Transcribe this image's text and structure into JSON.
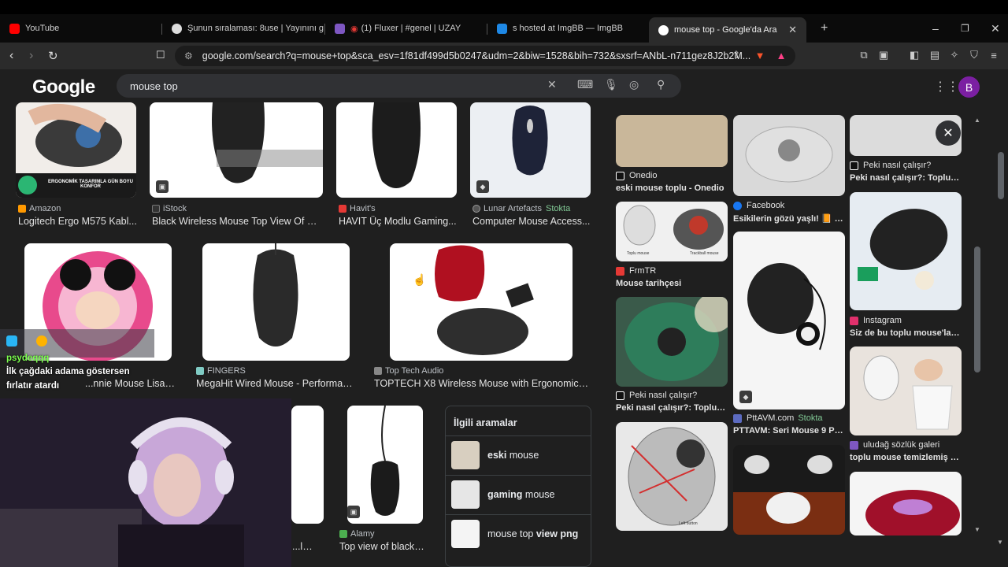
{
  "browser": {
    "tabs": [
      {
        "title": "YouTube",
        "color": "#ff0000"
      },
      {
        "title": "Şunun sıralaması: 8use | Yayınını güçl",
        "color": "#dddddd"
      },
      {
        "title": "(1) Fluxer | #genel | UZAY",
        "color": "#7e57c2"
      },
      {
        "title": "s hosted at ImgBB — ImgBB",
        "color": "#1e88e5"
      },
      {
        "title": "mouse top - Google'da Ara",
        "color": "#ffffff"
      }
    ],
    "new_tab": "+",
    "url": "google.com/search?q=mouse+top&sca_esv=1f81df499d5b0247&udm=2&biw=1528&bih=732&sxsrf=ANbL-n711gez8J2b2M..."
  },
  "google": {
    "logo": "Google",
    "query": "mouse top",
    "avatar": "B"
  },
  "left_results": [
    {
      "source": "Amazon",
      "title": "Logitech Ergo M575 Kabl...",
      "banner": "ERGONOMİK TASARIMLA GÜN BOYU KONFOR",
      "fav": "#ff9900"
    },
    {
      "source": "iStock",
      "title": "Black Wireless Mouse Top View Of G...",
      "fav": "#333333"
    },
    {
      "source": "Havit's",
      "title": "HAVIT Üç Modlu Gaming...",
      "fav": "#e53935"
    },
    {
      "source": "Lunar Artefacts",
      "stock": "Stokta",
      "title": "Computer Mouse Access...",
      "fav": "#555555"
    },
    {
      "source": "",
      "title": "...nnie Mouse Lisanslı Plast...",
      "fav": "#e91e63"
    },
    {
      "source": "FINGERS",
      "title": "MegaHit Wired Mouse - Performan...",
      "fav": "#80cbc4"
    },
    {
      "source": "Top Tech Audio",
      "title": "TOPTECH X8 Wireless Mouse with Ergonomic S...",
      "fav": "#888888"
    },
    {
      "source": "Alamy",
      "title": "Top view of black c...",
      "fav": "#4caf50"
    },
    {
      "partial_title": "...less"
    }
  ],
  "related": {
    "heading": "İlgili aramalar",
    "items": [
      {
        "bold": "eski",
        "rest": " mouse"
      },
      {
        "bold": "gaming",
        "rest": " mouse"
      },
      {
        "bold": "",
        "rest": "mouse top ",
        "bold2": "view png"
      }
    ]
  },
  "right_results": [
    {
      "source": "Onedio",
      "title": "eski mouse toplu - Onedio",
      "fav": "#ffffff"
    },
    {
      "source": "Facebook",
      "title": "Esikilerin gözü yaşlı! 📙 En...",
      "fav": "#1877f2"
    },
    {
      "source": "Peki nasıl çalışır?",
      "title": "Peki nasıl çalışır?: Toplu far...",
      "fav": "#ffffff"
    },
    {
      "source": "FrmTR",
      "title": "Mouse tarihçesi",
      "fav": "#e53935"
    },
    {
      "source": "Instagram",
      "title": "Siz de bu toplu mouse'larla...",
      "fav": "#e1306c"
    },
    {
      "source": "Peki nasıl çalışır?",
      "title": "Peki nasıl çalışır?: Toplu far...",
      "fav": "#ffffff"
    },
    {
      "source": "PttAVM.com",
      "stock": "Stokta",
      "title": "PTTAVM: Seri Mouse 9 Pin...",
      "fav": "#5c6bc0"
    },
    {
      "source": "uludağ sözlük galeri",
      "title": "toplu mouse temizlemiş ne...",
      "fav": "#7e57c2"
    }
  ],
  "overlay": {
    "chat_user": "psydeqqq",
    "chat_line1": "İlk çağdaki adama göstersen",
    "chat_line2": "fırlatır atardı"
  },
  "image_captions": {
    "ikea_trackball": "Toplu mouse",
    "trackball_label": "Trackball mouse",
    "cutaway_label": "Left button"
  }
}
